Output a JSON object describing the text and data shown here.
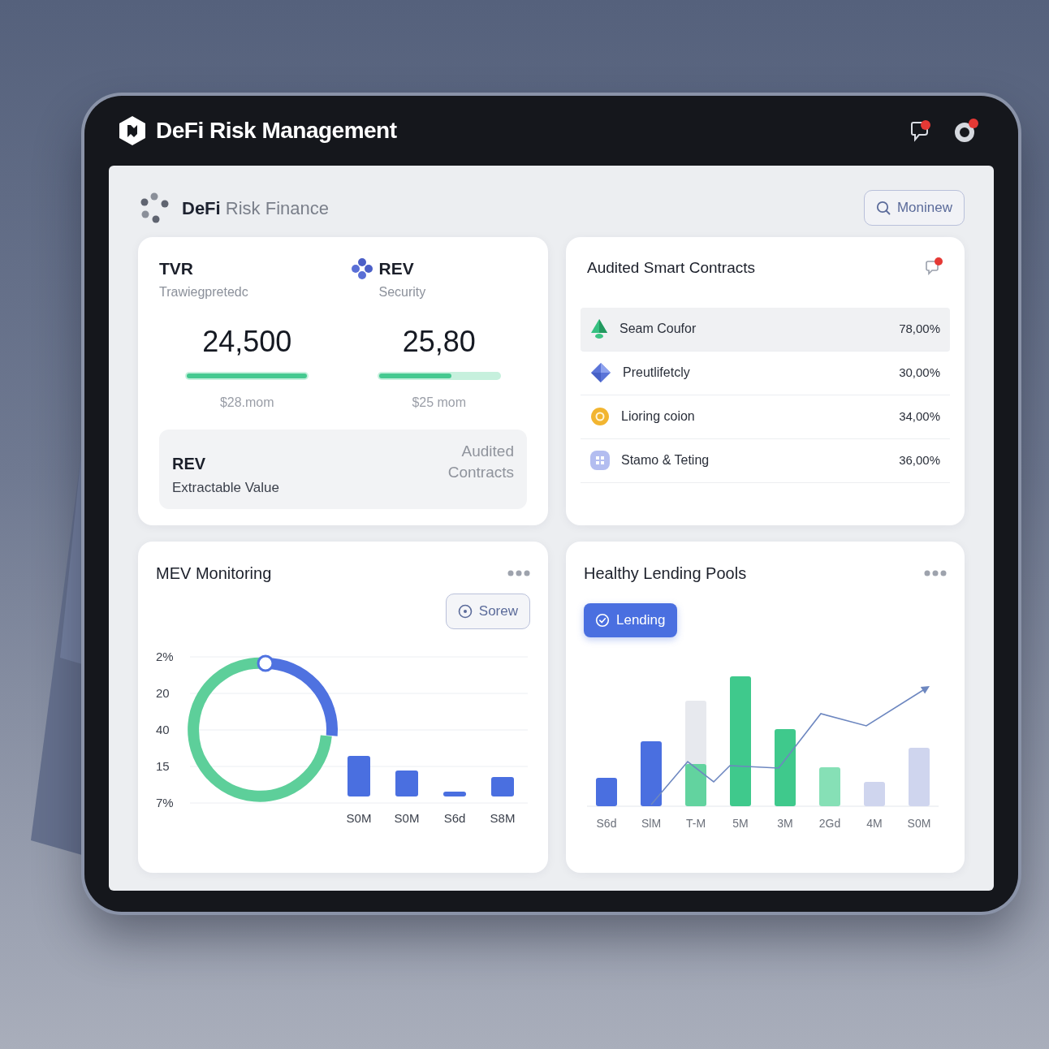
{
  "window": {
    "title": "DeFi Risk Management"
  },
  "brand": {
    "text": "**DeFi** Risk Finance",
    "button": "Moninew"
  },
  "metrics": [
    {
      "kind": "plain",
      "title": "TVR",
      "subtitle": "Trawiegpretedc",
      "value": "24,500",
      "level": 1,
      "note": "$28.mom"
    },
    {
      "kind": "token",
      "title": "REV",
      "subtitle": "Security",
      "value": "25,80",
      "level": 0.6,
      "note": "$25 mom"
    }
  ],
  "summary": {
    "title": "REV",
    "subtitle": "Extractable Value",
    "note": "Audited Contracts"
  },
  "contracts": {
    "title": "Audited Smart Contracts",
    "rows": [
      {
        "kind": "tree",
        "name": "Seam Coufor",
        "value": "78,00%",
        "selected": true
      },
      {
        "kind": "gem",
        "name": "Preutlifetcly",
        "value": "30,00%",
        "selected": false
      },
      {
        "kind": "coin",
        "name": "Lioring coion",
        "value": "34,00%",
        "selected": false
      },
      {
        "kind": "tile",
        "name": "Stamo & Teting",
        "value": "36,00%",
        "selected": false
      }
    ]
  },
  "mev": {
    "title": "MEV Monitoring",
    "button": "Sorew",
    "y_labels": [
      "2%",
      "20",
      "40",
      "15",
      "7%"
    ],
    "x_labels": [
      "S0M",
      "S0M",
      "S6d",
      "S8M"
    ]
  },
  "lending": {
    "title": "Healthy Lending Pools",
    "button": "Lending",
    "x_labels": [
      "S6d",
      "SlM",
      "T-M",
      "5M",
      "3M",
      "2Gd",
      "4M",
      "S0M"
    ]
  }
}
